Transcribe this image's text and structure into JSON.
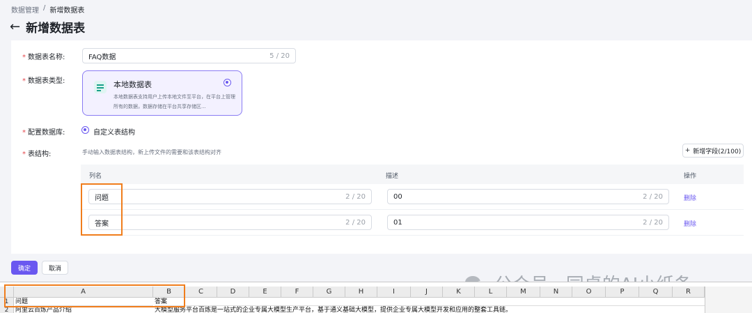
{
  "breadcrumb": {
    "root": "数据管理",
    "sep": "/",
    "current": "新增数据表"
  },
  "header": {
    "title": "新增数据表"
  },
  "form": {
    "name_label": "数据表名称:",
    "name_value": "FAQ数据",
    "name_count": "5 / 20",
    "type_label": "数据表类型:",
    "type_option": {
      "name": "本地数据表",
      "desc": "本地数据表支持用户上传本地文件至平台，在平台上管理所有的数据，数据存储在平台共享存储区..."
    },
    "db_label": "配置数据库:",
    "db_option": "自定义表结构",
    "structure_label": "表结构:",
    "structure_hint": "手动输入数据表结构，新上传文件的需要和该表结构对齐",
    "add_field_label": "新增字段(2/100)"
  },
  "table": {
    "headers": {
      "col_name": "列名",
      "desc": "描述",
      "action": "操作"
    },
    "rows": [
      {
        "name": "问题",
        "name_count": "2 / 20",
        "desc": "00",
        "desc_count": "2 / 20",
        "action": "删除"
      },
      {
        "name": "答案",
        "name_count": "2 / 20",
        "desc": "01",
        "desc_count": "2 / 20",
        "action": "删除"
      }
    ]
  },
  "footer": {
    "ok_label": "确定",
    "cancel_label": "取消"
  },
  "watermark": {
    "text": "公众号 · 同桌的AI小纸条"
  },
  "spreadsheet": {
    "columns": [
      "A",
      "B",
      "C",
      "D",
      "E",
      "F",
      "G",
      "H",
      "I",
      "J",
      "K",
      "L",
      "M",
      "N",
      "O",
      "P",
      "Q",
      "R"
    ],
    "rows": [
      {
        "num": "1",
        "a": "问题",
        "b": "答案"
      },
      {
        "num": "2",
        "a": "阿里云百炼产品介绍",
        "b": "大模型服务平台百炼是一站式的企业专属大模型生产平台，基于通义基础大模型，提供企业专属大模型开发和应用的整套工具链。"
      }
    ]
  },
  "colors": {
    "accent": "#6a58f0",
    "highlight": "#f07d1c",
    "required": "#e5484d"
  }
}
